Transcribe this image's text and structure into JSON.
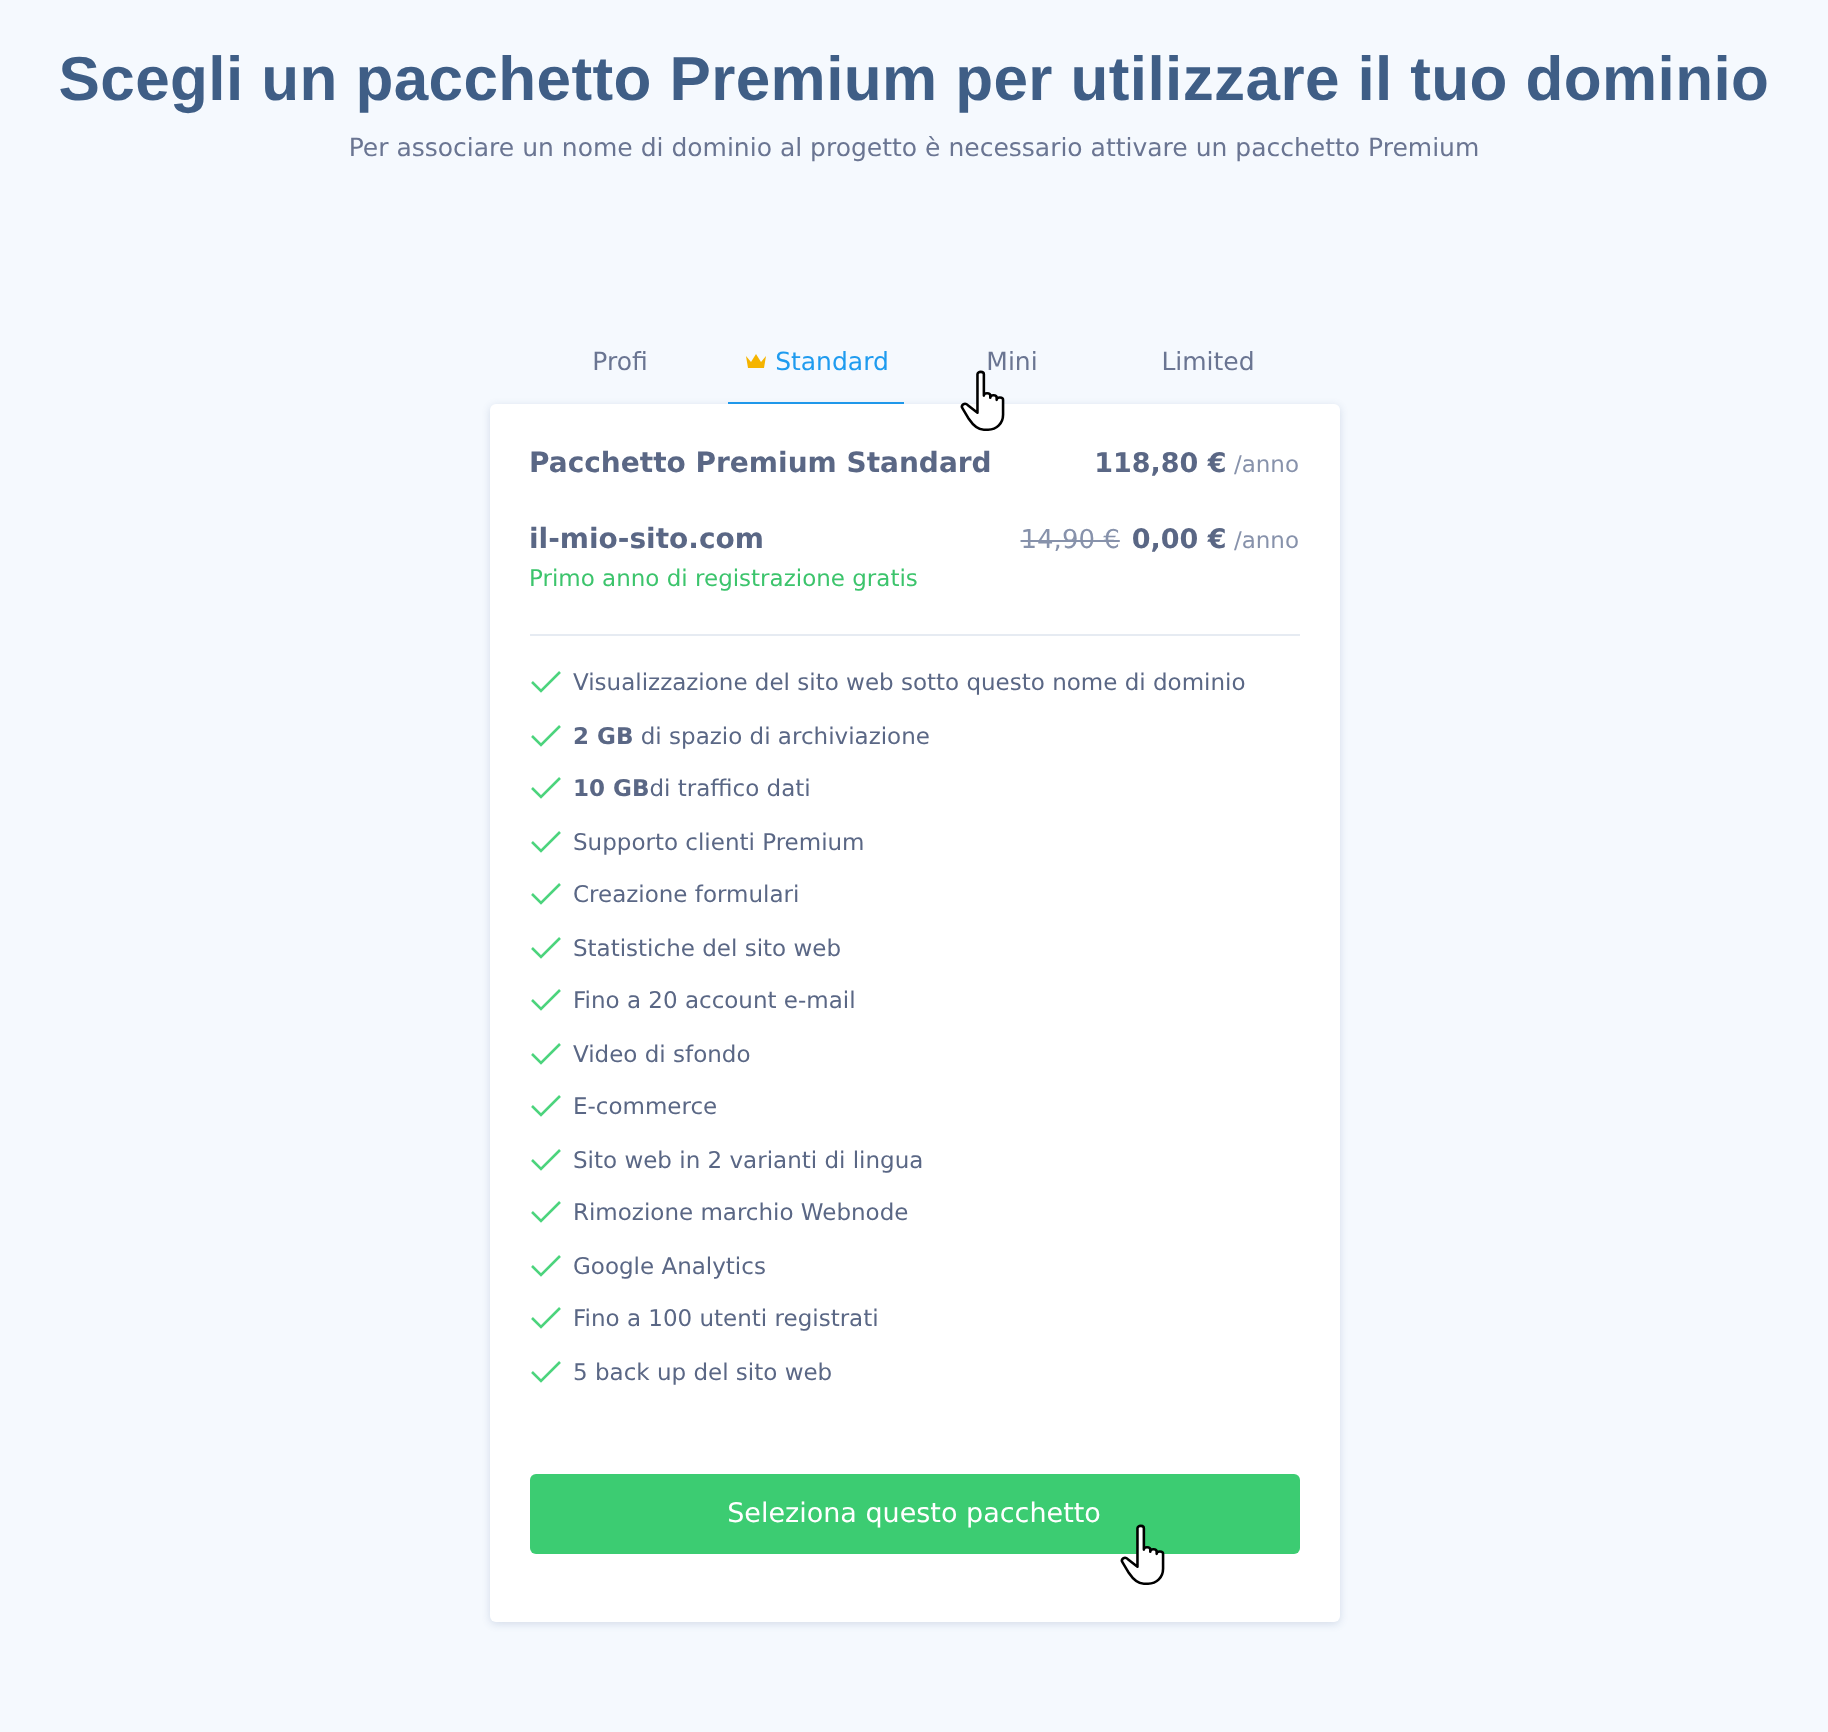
{
  "heading": {
    "title": "Scegli un pacchetto Premium per utilizzare il tuo dominio",
    "subtitle": "Per associare un nome di dominio al progetto è necessario attivare un pacchetto Premium"
  },
  "tabs": [
    {
      "label": "Profi",
      "selected": false,
      "crown": false
    },
    {
      "label": "Standard",
      "selected": true,
      "crown": true
    },
    {
      "label": "Mini",
      "selected": false,
      "crown": false
    },
    {
      "label": "Limited",
      "selected": false,
      "crown": false
    }
  ],
  "package": {
    "name": "Pacchetto Premium Standard",
    "price": "118,80 €",
    "period": "/anno"
  },
  "domain": {
    "name": "il-mio-sito.com",
    "note": "Primo anno di registrazione gratis",
    "old_price": "14,90 €",
    "price": "0,00 €",
    "period": "/anno"
  },
  "features": [
    "Visualizzazione del sito web sotto questo nome di dominio",
    "**2 GB** di spazio di archiviazione",
    "**10 GB**di traffico dati",
    "Supporto clienti Premium",
    "Creazione formulari",
    "Statistiche del sito web",
    "Fino a 20 account e-mail",
    "Video di sfondo",
    "E-commerce",
    "Sito web in 2 varianti di lingua",
    "Rimozione marchio Webnode",
    "Google Analytics",
    "Fino a 100 utenti registrati",
    "5 back up del sito web"
  ],
  "button": {
    "label": "Seleziona questo pacchetto"
  }
}
